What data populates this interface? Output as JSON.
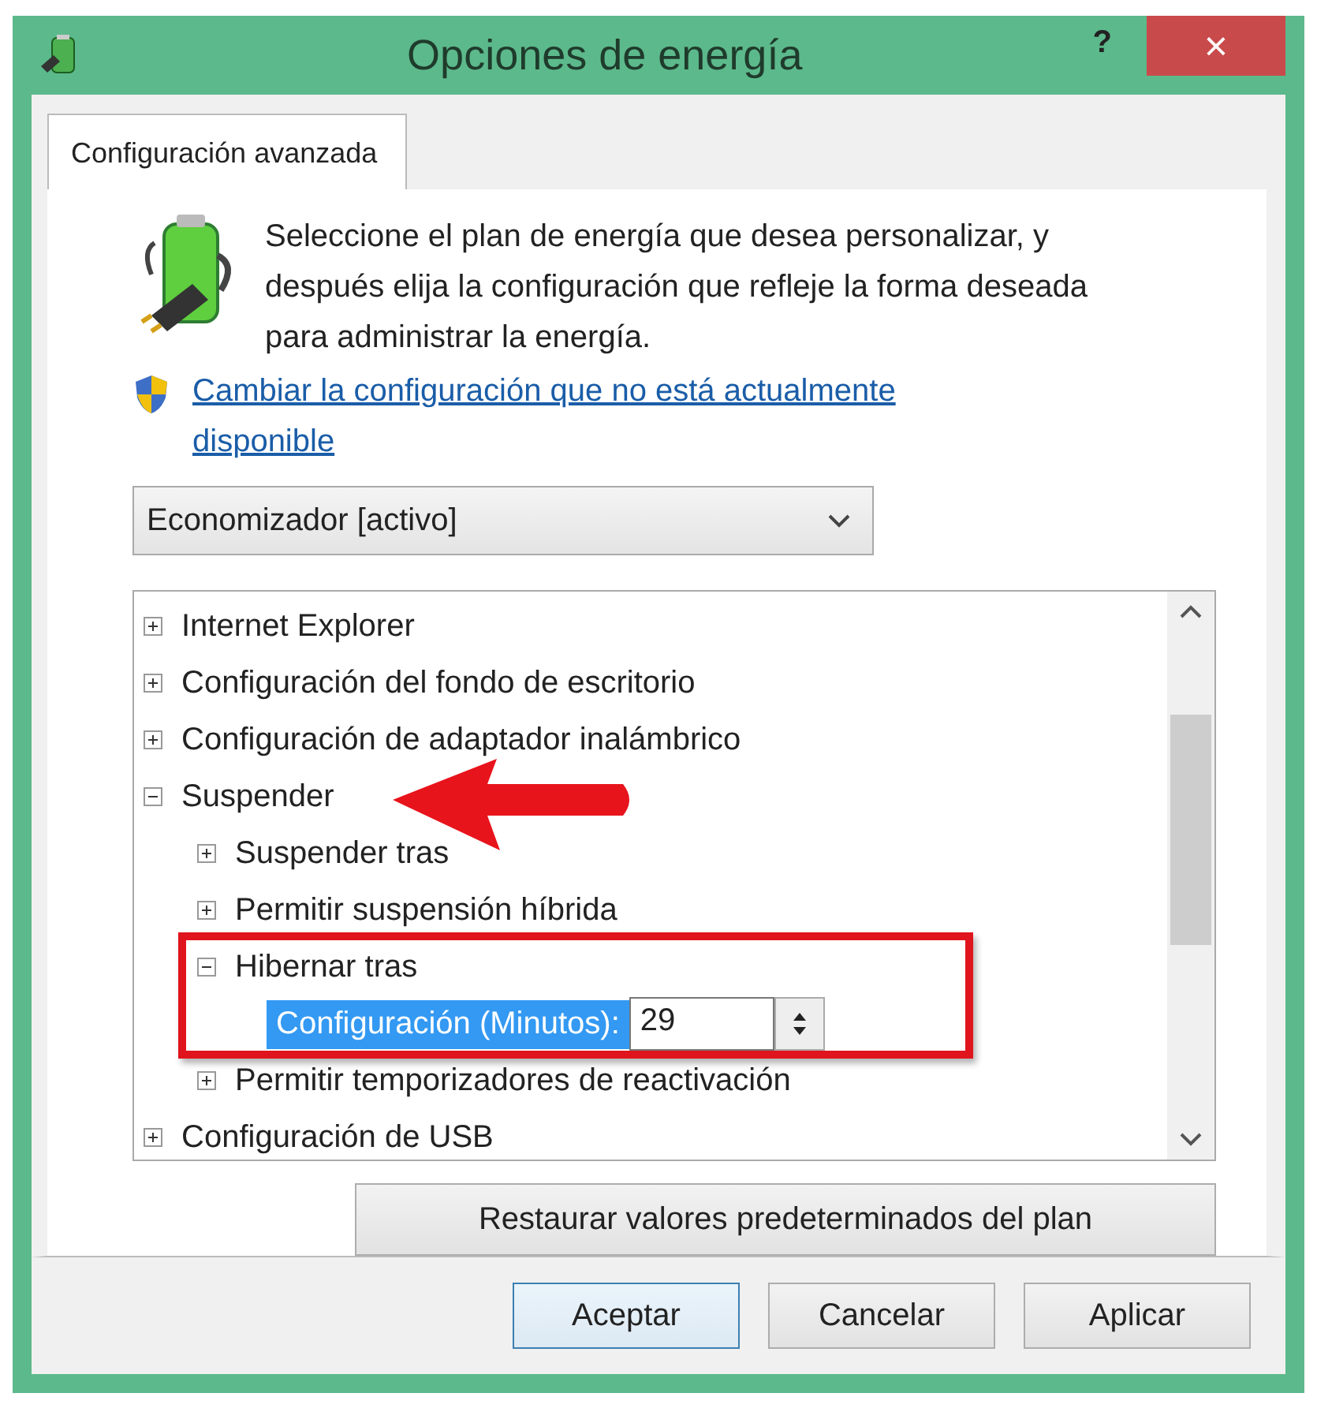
{
  "window": {
    "title": "Opciones de energía",
    "help_label": "?",
    "close_label": "×"
  },
  "tabs": [
    {
      "label": "Configuración avanzada",
      "selected": true
    }
  ],
  "intro": "Seleccione el plan de energía que desea personalizar, y después elija la configuración que refleje la forma deseada para administrar la energía.",
  "admin_link": "Cambiar la configuración que no está actualmente disponible",
  "plan_dropdown": {
    "value": "Economizador [activo]"
  },
  "tree": [
    {
      "label": "Internet Explorer",
      "expanded": false
    },
    {
      "label": "Configuración del fondo de escritorio",
      "expanded": false
    },
    {
      "label": "Configuración de adaptador inalámbrico",
      "expanded": false
    },
    {
      "label": "Suspender",
      "expanded": true,
      "children": [
        {
          "label": "Suspender tras",
          "expanded": false
        },
        {
          "label": "Permitir suspensión híbrida",
          "expanded": false
        },
        {
          "label": "Hibernar tras",
          "expanded": true,
          "children": [
            {
              "kind": "setting",
              "label": "Configuración (Minutos):",
              "selected": true,
              "value": "29"
            }
          ]
        },
        {
          "label": "Permitir temporizadores de reactivación",
          "expanded": false
        }
      ]
    },
    {
      "label": "Configuración de USB",
      "expanded": false
    }
  ],
  "restore_button": "Restaurar valores predeterminados del plan",
  "buttons": [
    {
      "label": "Aceptar",
      "default": true
    },
    {
      "label": "Cancelar",
      "default": false
    },
    {
      "label": "Aplicar",
      "default": false
    }
  ]
}
